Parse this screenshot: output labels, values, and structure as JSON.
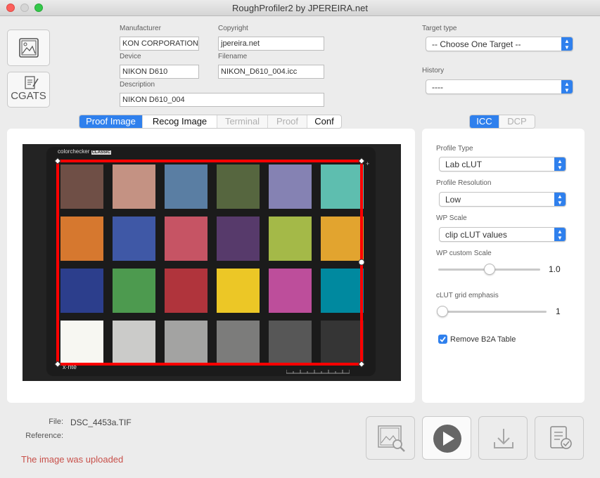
{
  "window": {
    "title": "RoughProfiler2 by JPEREIRA.net"
  },
  "left_buttons": {
    "cgats_label": "CGATS"
  },
  "meta": {
    "manufacturer_label": "Manufacturer",
    "manufacturer_value": "KON CORPORATION",
    "copyright_label": "Copyright",
    "copyright_value": "jpereira.net",
    "device_label": "Device",
    "device_value": "NIKON D610",
    "filename_label": "Filename",
    "filename_value": "NIKON_D610_004.icc",
    "description_label": "Description",
    "description_value": "NIKON D610_004"
  },
  "target": {
    "type_label": "Target type",
    "type_value": "-- Choose One Target --",
    "history_label": "History",
    "history_value": "----"
  },
  "tabs": [
    "Proof Image",
    "Recog Image",
    "Terminal",
    "Proof",
    "Conf"
  ],
  "profile_tabs": [
    "ICC",
    "DCP"
  ],
  "settings": {
    "profile_type_label": "Profile Type",
    "profile_type_value": "Lab cLUT",
    "profile_resolution_label": "Profile Resolution",
    "profile_resolution_value": "Low",
    "wp_scale_label": "WP Scale",
    "wp_scale_value": "clip cLUT values",
    "wp_custom_label": "WP custom Scale",
    "wp_custom_value": "1.0",
    "wp_custom_level": 0.5,
    "clut_grid_label": "cLUT grid emphasis",
    "clut_grid_value": "1",
    "clut_grid_level": 0.0,
    "remove_b2a_label": "Remove B2A Table",
    "remove_b2a_checked": true
  },
  "chart_image": {
    "brand_text": "colorchecker",
    "brand_badge": "CLASSIC",
    "xrite_text": "x·rite",
    "patches": [
      "#6f4f46",
      "#c49283",
      "#5a7ea3",
      "#56663f",
      "#8582b3",
      "#5ebeaf",
      "#d6782f",
      "#3f58a6",
      "#c65464",
      "#573a6b",
      "#a4b948",
      "#e2a42f",
      "#2c3e8c",
      "#4d9a4f",
      "#b0343c",
      "#ecc726",
      "#bd4e9b",
      "#00899f",
      "#f7f7f2",
      "#cbcbc9",
      "#a3a3a2",
      "#7c7c7b",
      "#575757",
      "#353535"
    ]
  },
  "status": {
    "file_label": "File:",
    "file_value": "DSC_4453a.TIF",
    "reference_label": "Reference:",
    "reference_value": "",
    "message": "The image was uploaded"
  },
  "colors": {
    "accent": "#2f80ed",
    "frame": "#ff0000",
    "status_message": "#c8504a"
  }
}
